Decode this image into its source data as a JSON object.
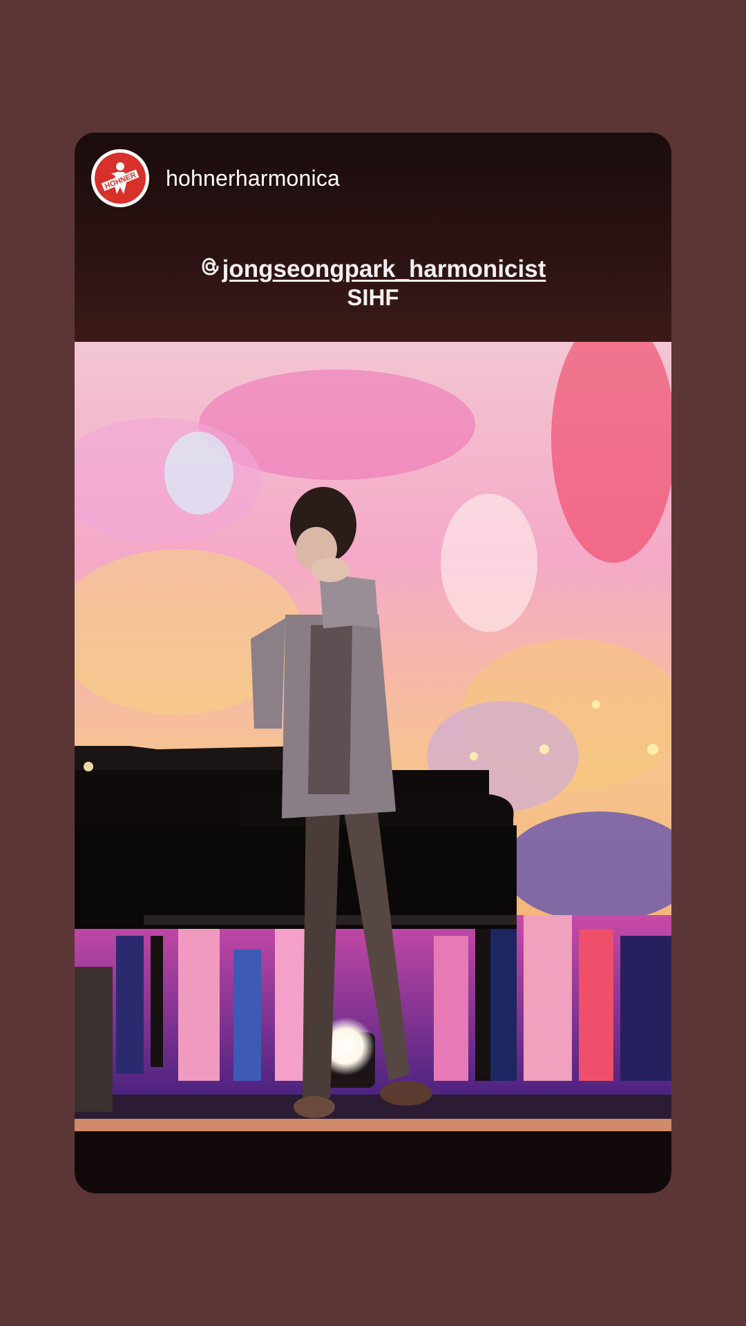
{
  "story": {
    "account": {
      "username": "hohnerharmonica",
      "avatar_icon": "hohner-logo-icon",
      "avatar_text": "HOHNER",
      "brand_color": "#d8302a"
    },
    "caption": {
      "mention_icon": "threads-at-icon",
      "mention": "jongseongpark_harmonicist",
      "line2": "SIHF"
    },
    "photo": {
      "subject": "performer-playing-harmonica",
      "props": [
        "grand-piano",
        "stage-spotlight",
        "led-backdrop"
      ]
    },
    "colors": {
      "page_background": "#5c3637",
      "card_top": "#1b0c0c",
      "text": "#ffffff"
    }
  }
}
